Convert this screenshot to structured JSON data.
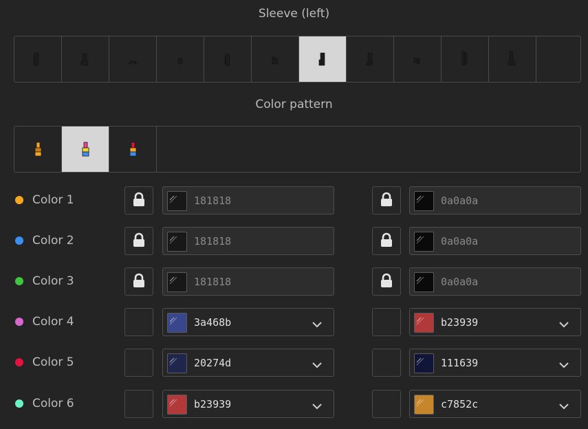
{
  "sleeve_section": {
    "title": "Sleeve (left)",
    "items": [
      {
        "id": "sleeve-1",
        "selected": false
      },
      {
        "id": "sleeve-2",
        "selected": false
      },
      {
        "id": "sleeve-3",
        "selected": false
      },
      {
        "id": "sleeve-4",
        "selected": false
      },
      {
        "id": "sleeve-5",
        "selected": false
      },
      {
        "id": "sleeve-6",
        "selected": false
      },
      {
        "id": "sleeve-7",
        "selected": true
      },
      {
        "id": "sleeve-8",
        "selected": false
      },
      {
        "id": "sleeve-9",
        "selected": false
      },
      {
        "id": "sleeve-10",
        "selected": false
      },
      {
        "id": "sleeve-11",
        "selected": false
      },
      {
        "id": "sleeve-12",
        "selected": false
      }
    ]
  },
  "pattern_section": {
    "title": "Color pattern",
    "items": [
      {
        "id": "pattern-1",
        "selected": false
      },
      {
        "id": "pattern-2",
        "selected": true
      },
      {
        "id": "pattern-3",
        "selected": false
      }
    ]
  },
  "color_rows": [
    {
      "label": "Color 1",
      "dot": "#f5a623",
      "locked": true,
      "left": {
        "hex": "181818",
        "color": "#181818"
      },
      "right": {
        "hex": "0a0a0a",
        "color": "#0a0a0a"
      }
    },
    {
      "label": "Color 2",
      "dot": "#3b8ff0",
      "locked": true,
      "left": {
        "hex": "181818",
        "color": "#181818"
      },
      "right": {
        "hex": "0a0a0a",
        "color": "#0a0a0a"
      }
    },
    {
      "label": "Color 3",
      "dot": "#3fc53f",
      "locked": true,
      "left": {
        "hex": "181818",
        "color": "#181818"
      },
      "right": {
        "hex": "0a0a0a",
        "color": "#0a0a0a"
      }
    },
    {
      "label": "Color 4",
      "dot": "#d967cf",
      "locked": false,
      "left": {
        "hex": "3a468b",
        "color": "#3a468b"
      },
      "right": {
        "hex": "b23939",
        "color": "#b23939"
      }
    },
    {
      "label": "Color 5",
      "dot": "#e3123f",
      "locked": false,
      "left": {
        "hex": "20274d",
        "color": "#20274d"
      },
      "right": {
        "hex": "111639",
        "color": "#111639"
      }
    },
    {
      "label": "Color 6",
      "dot": "#6ef0c6",
      "locked": false,
      "left": {
        "hex": "b23939",
        "color": "#b23939"
      },
      "right": {
        "hex": "c7852c",
        "color": "#c7852c"
      }
    }
  ],
  "icons": {
    "lock": "lock-icon",
    "dropdown": "chevron-down-icon",
    "gloss": "gloss-icon"
  }
}
